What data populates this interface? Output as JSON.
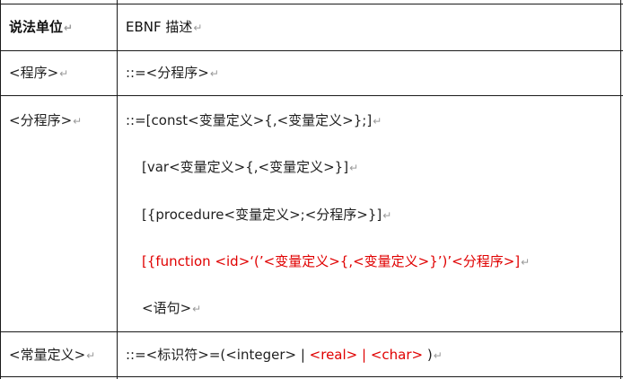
{
  "table": {
    "header": {
      "unit": "说法单位",
      "ebnf": "EBNF 描述"
    },
    "rows": [
      {
        "unit": "<程序>",
        "lines": [
          {
            "text": "::=<分程序>"
          }
        ]
      },
      {
        "unit": "<分程序>",
        "lines": [
          {
            "text": "::=[const<变量定义>{,<变量定义>};]"
          },
          {
            "text": "[var<变量定义>{,<变量定义>}]"
          },
          {
            "text": "[{procedure<变量定义>;<分程序>}]"
          },
          {
            "text": "[{function <id>‘(’<变量定义>{,<变量定义>}’)’<分程序>]"
          },
          {
            "text": "<语句>"
          }
        ]
      },
      {
        "unit": "<常量定义>",
        "segments": {
          "prefix": "::=<标识符>=(<integer> | ",
          "real": "<real>",
          "sep": " | ",
          "char": "<char>",
          "suffix": " )"
        }
      }
    ],
    "paragraph_mark": "↵",
    "colors": {
      "text": "#1f1f1f",
      "highlight": "#e00000",
      "paragraph_mark": "#9a9a9a",
      "border": "#1a1a1a"
    }
  }
}
